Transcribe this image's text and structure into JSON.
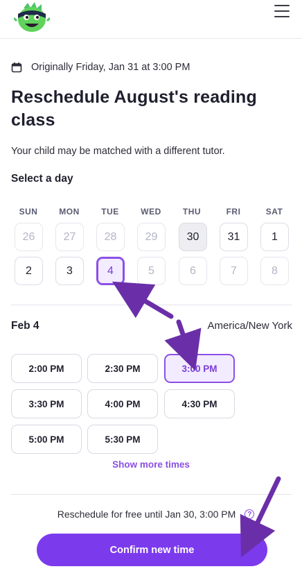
{
  "header": {
    "logo_icon": "classdojo-monster-logo",
    "menu_icon": "hamburger-menu-icon"
  },
  "original": {
    "icon": "calendar-icon",
    "text": "Originally Friday, Jan 31 at 3:00 PM"
  },
  "title": "Reschedule August's reading class",
  "subtitle": "Your child may be matched with a different tutor.",
  "select_day_label": "Select a day",
  "calendar": {
    "weekdays": [
      "SUN",
      "MON",
      "TUE",
      "WED",
      "THU",
      "FRI",
      "SAT"
    ],
    "week1": [
      "26",
      "27",
      "28",
      "29",
      "30",
      "31",
      "1"
    ],
    "week2": [
      "2",
      "3",
      "4",
      "5",
      "6",
      "7",
      "8"
    ],
    "selected_day": "4"
  },
  "times": {
    "date_label": "Feb 4",
    "timezone": "America/New York",
    "slots": [
      "2:00 PM",
      "2:30 PM",
      "3:00 PM",
      "3:30 PM",
      "4:00 PM",
      "4:30 PM",
      "5:00 PM",
      "5:30 PM"
    ],
    "selected_slot": "3:00 PM",
    "show_more": "Show more times"
  },
  "footer": {
    "free_text": "Reschedule for free until Jan 30, 3:00 PM",
    "help_glyph": "?",
    "help_icon": "question-circle-icon",
    "confirm_label": "Confirm new time"
  },
  "colors": {
    "accent": "#7c3aed",
    "accent_light": "#f3ebff",
    "annotation_arrow": "#6a2fa8"
  }
}
